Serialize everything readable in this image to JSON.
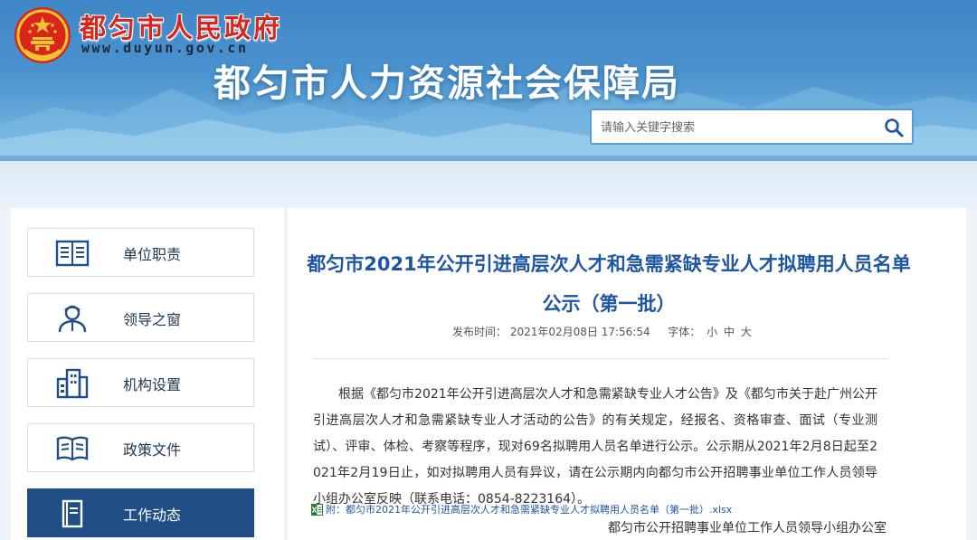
{
  "header": {
    "gov_title": "都匀市人民政府",
    "gov_url": "www.duyun.gov.cn",
    "bureau_title": "都匀市人力资源社会保障局",
    "emblem_icon": "national-emblem-icon"
  },
  "search": {
    "placeholder": "请输入关键字搜索",
    "icon": "search-icon"
  },
  "sidebar": {
    "items": [
      {
        "label": "单位职责",
        "icon": "book-icon",
        "active": false
      },
      {
        "label": "领导之窗",
        "icon": "person-icon",
        "active": false
      },
      {
        "label": "机构设置",
        "icon": "building-icon",
        "active": false
      },
      {
        "label": "政策文件",
        "icon": "open-book-icon",
        "active": false
      },
      {
        "label": "工作动态",
        "icon": "document-icon",
        "active": true
      }
    ]
  },
  "article": {
    "title": "都匀市2021年公开引进高层次人才和急需紧缺专业人才拟聘用人员名单公示（第一批）",
    "publish_label": "发布时间：",
    "publish_time": "2021年02月08日 17:56:54",
    "font_label": "字体：",
    "font_sizes": [
      "小",
      "中",
      "大"
    ],
    "body": "根据《都匀市2021年公开引进高层次人才和急需紧缺专业人才公告》及《都匀市关于赴广州公开引进高层次人才和急需紧缺专业人才活动的公告》的有关规定，经报名、资格审查、面试（专业测试）、评审、体检、考察等程序，现对69名拟聘用人员名单进行公示。公示期从2021年2月8日起至2021年2月19日止，如对拟聘用人员有异议，请在公示期内向都匀市公开招聘事业单位工作人员领导小组办公室反映（联系电话：0854-8223164）。",
    "attachment": "附：都匀市2021年公开引进高层次人才和急需紧缺专业人才拟聘用人员名单（第一批）.xlsx",
    "signature": "都匀市公开招聘事业单位工作人员领导小组办公室"
  },
  "colors": {
    "header_blue": "#4b93cf",
    "gov_red": "#d8261c",
    "title_blue": "#1f56a3",
    "active_nav": "#1f4f86"
  }
}
